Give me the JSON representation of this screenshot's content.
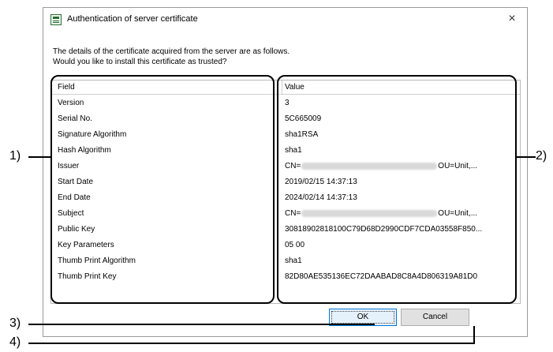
{
  "window": {
    "title": "Authentication of server certificate",
    "close_glyph": "×",
    "app_icon": "certificate-app-icon"
  },
  "message": {
    "line1": "The details of the certificate acquired from the server are as follows.",
    "line2": "Would you like to install this certificate as trusted?"
  },
  "grid": {
    "columns": [
      "Field",
      "Value"
    ],
    "rows": [
      {
        "field": "Version",
        "value": "3"
      },
      {
        "field": "Serial No.",
        "value": "5C665009"
      },
      {
        "field": "Signature Algorithm",
        "value": "sha1RSA"
      },
      {
        "field": "Hash Algorithm",
        "value": "sha1"
      },
      {
        "field": "Issuer",
        "value_prefix": "CN=",
        "value_suffix": "OU=Unit,..."
      },
      {
        "field": "Start Date",
        "value": "2019/02/15 14:37:13"
      },
      {
        "field": "End Date",
        "value": "2024/02/14 14:37:13"
      },
      {
        "field": "Subject",
        "value_prefix": "CN=",
        "value_suffix": "OU=Unit,..."
      },
      {
        "field": "Public Key",
        "value": "30818902818100C79D68D2990CDF7CDA03558F850..."
      },
      {
        "field": "Key Parameters",
        "value": "05 00"
      },
      {
        "field": "Thumb Print Algorithm",
        "value": "sha1"
      },
      {
        "field": "Thumb Print Key",
        "value": "82D80AE535136EC72DAABAD8C8A4D806319A81D0"
      }
    ]
  },
  "buttons": {
    "ok": "OK",
    "cancel": "Cancel"
  },
  "callouts": {
    "c1": "1)",
    "c2": "2)",
    "c3": "3)",
    "c4": "4)"
  }
}
